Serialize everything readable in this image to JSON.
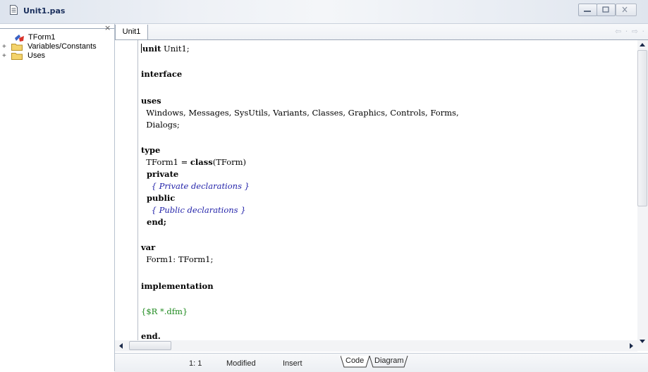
{
  "window": {
    "title": "Unit1.pas",
    "controls": [
      "minimize",
      "restore",
      "close"
    ]
  },
  "tree": {
    "close_glyph": "×",
    "items": [
      {
        "label": "TForm1",
        "icon": "form-icon",
        "expandable": false
      },
      {
        "label": "Variables/Constants",
        "icon": "folder-icon",
        "expandable": true,
        "toggle": "+"
      },
      {
        "label": "Uses",
        "icon": "folder-icon",
        "expandable": true,
        "toggle": "+"
      }
    ]
  },
  "editor": {
    "tab_label": "Unit1",
    "nav_back": "⇦ ·",
    "nav_forward": "⇨ ·",
    "code": {
      "l1_kw": "unit",
      "l1_rest": " Unit1;",
      "l2": "interface",
      "l3": "uses",
      "l4": "  Windows, Messages, SysUtils, Variants, Classes, Graphics, Controls, Forms,",
      "l5": "  Dialogs;",
      "l6": "type",
      "l7_a": "  TForm1 = ",
      "l7_kw": "class",
      "l7_b": "(TForm)",
      "l8": "  private",
      "l9": "    { Private declarations }",
      "l10": "  public",
      "l11": "    { Public declarations }",
      "l12": "  end;",
      "l13": "var",
      "l14": "  Form1: TForm1;",
      "l15": "implementation",
      "l16": "{$R *.dfm}",
      "l17": "end."
    }
  },
  "status": {
    "position": "1:  1",
    "modified": "Modified",
    "mode": "Insert",
    "tab_code": "Code",
    "tab_diagram": "Diagram"
  },
  "colors": {
    "keyword": "#000000",
    "comment": "#1f1fa8",
    "directive": "#1e8a1e",
    "title_text": "#1a2f5c"
  }
}
